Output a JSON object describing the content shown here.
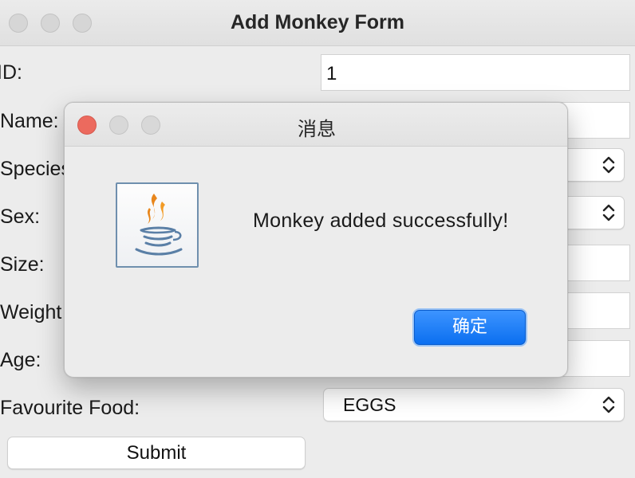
{
  "window": {
    "title": "Add Monkey Form"
  },
  "form": {
    "id_label": "ID:",
    "id_value": "1",
    "name_label": "Name:",
    "species_label": "Species",
    "sex_label": "Sex:",
    "size_label": "Size:",
    "weight_label": "Weight",
    "age_label": "Age:",
    "favourite_food_label": "Favourite Food:",
    "favourite_food_value": "EGGS",
    "submit_label": "Submit"
  },
  "dialog": {
    "title": "消息",
    "message": "Monkey added successfully!",
    "ok_label": "确定",
    "icon": "java-coffee-cup-icon"
  },
  "colors": {
    "accent_button": "#0b6ff0",
    "close_red": "#ec6a5e"
  }
}
